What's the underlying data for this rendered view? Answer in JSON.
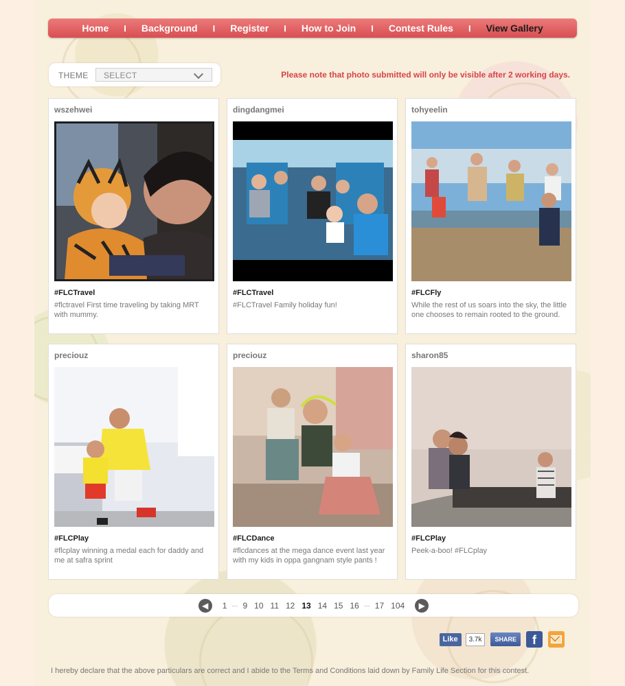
{
  "nav": {
    "items": [
      "Home",
      "Background",
      "Register",
      "How to Join",
      "Contest Rules",
      "View Gallery"
    ],
    "active": "View Gallery",
    "color": "#d84f52"
  },
  "filter": {
    "label": "THEME",
    "select_value": "SELECT"
  },
  "notice": "Please note that photo submitted will only be visible after 2 working days.",
  "posts": [
    {
      "user": "wszehwei",
      "tag": "#FLCTravel",
      "caption": "#flctravel First time traveling by taking MRT with mummy."
    },
    {
      "user": "dingdangmei",
      "tag": "#FLCTravel",
      "caption": "#FLCTravel Family holiday fun!"
    },
    {
      "user": "tohyeelin",
      "tag": "#FLCFly",
      "caption": "While the rest of us soars into the sky, the little one chooses to remain rooted to the ground."
    },
    {
      "user": "preciouz",
      "tag": "#FLCPlay",
      "caption": "#flcplay winning a medal each for daddy and me at safra sprint"
    },
    {
      "user": "preciouz",
      "tag": "#FLCDance",
      "caption": "#flcdances at the mega dance event last year with my kids in oppa gangnam style pants !"
    },
    {
      "user": "sharon85",
      "tag": "#FLCPlay",
      "caption": "Peek-a-boo! #FLCplay"
    }
  ],
  "pagination": {
    "pages": [
      "1",
      "9",
      "10",
      "11",
      "12",
      "13",
      "14",
      "15",
      "16",
      "17",
      "104"
    ],
    "current": "13",
    "ellipsis": "···"
  },
  "social": {
    "like_label": "Like",
    "like_count": "3.7k",
    "share_label": "SHARE",
    "fb_icon": "f"
  },
  "footer": "I hereby declare that the above particulars are correct and I abide to the Terms and Conditions laid down by Family Life Section for this contest."
}
